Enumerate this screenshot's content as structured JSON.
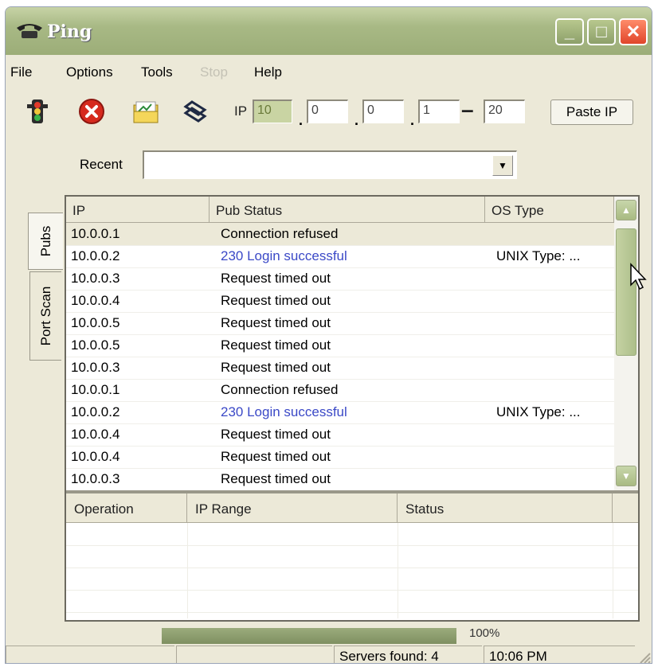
{
  "window": {
    "title": "Ping",
    "controls": {
      "minimize": "_",
      "maximize": "□",
      "close": "✕"
    }
  },
  "menu": [
    {
      "label": "File",
      "enabled": true
    },
    {
      "label": "Options",
      "enabled": true
    },
    {
      "label": "Tools",
      "enabled": true
    },
    {
      "label": "Stop",
      "enabled": false
    },
    {
      "label": "Help",
      "enabled": true
    }
  ],
  "toolbar": {
    "ip_label": "IP",
    "ip_octets": [
      "10",
      "0",
      "0",
      "1"
    ],
    "ip_range_separator": "–",
    "ip_range_end": "20",
    "paste_ip_label": "Paste IP",
    "icons": [
      "traffic-light-icon",
      "stop-icon",
      "open-folder-icon",
      "connect-icon"
    ]
  },
  "recent": {
    "label": "Recent",
    "value": ""
  },
  "tabs": [
    {
      "label": "Pubs",
      "active": true
    },
    {
      "label": "Port Scan",
      "active": false
    }
  ],
  "results": {
    "columns": [
      "IP",
      "Pub Status",
      "OS Type"
    ],
    "rows": [
      {
        "ip": "10.0.0.1",
        "status": "Connection refused",
        "os": "",
        "highlight": false
      },
      {
        "ip": "10.0.0.2",
        "status": "230 Login successful",
        "os": "UNIX Type: ...",
        "highlight": true
      },
      {
        "ip": "10.0.0.3",
        "status": "Request timed out",
        "os": "",
        "highlight": false
      },
      {
        "ip": "10.0.0.4",
        "status": "Request timed out",
        "os": "",
        "highlight": false
      },
      {
        "ip": "10.0.0.5",
        "status": "Request timed out",
        "os": "",
        "highlight": false
      },
      {
        "ip": "10.0.0.5",
        "status": "Request timed out",
        "os": "",
        "highlight": false
      },
      {
        "ip": "10.0.0.3",
        "status": "Request timed out",
        "os": "",
        "highlight": false
      },
      {
        "ip": "10.0.0.1",
        "status": "Connection refused",
        "os": "",
        "highlight": false
      },
      {
        "ip": "10.0.0.2",
        "status": "230 Login successful",
        "os": "UNIX Type: ...",
        "highlight": true
      },
      {
        "ip": "10.0.0.4",
        "status": "Request timed out",
        "os": "",
        "highlight": false
      },
      {
        "ip": "10.0.0.4",
        "status": "Request timed out",
        "os": "",
        "highlight": false
      },
      {
        "ip": "10.0.0.3",
        "status": "Request timed out",
        "os": "",
        "highlight": false
      }
    ]
  },
  "operations": {
    "columns": [
      "Operation",
      "IP Range",
      "Status"
    ],
    "rows": []
  },
  "progress": {
    "value": 1.0,
    "text": "100%"
  },
  "statusbar": {
    "panels": [
      "",
      "",
      "Servers found: 4",
      "10:06 PM"
    ]
  },
  "colors": {
    "title_bar": "#a8b985",
    "link_blue": "#3b49c7",
    "window_bg": "#ece9d8"
  }
}
